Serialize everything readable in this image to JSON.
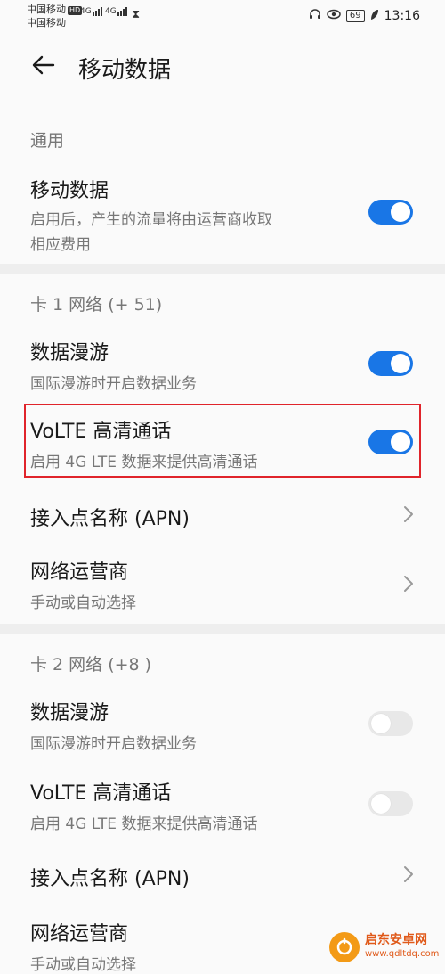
{
  "status_bar": {
    "carrier1": "中国移动",
    "carrier1_badge": "HD",
    "carrier2": "中国移动",
    "sig1_label": "4G",
    "sig2_label": "4G",
    "battery": "69",
    "time": "13:16",
    "icons": [
      "headset-icon",
      "eye-icon",
      "battery-icon",
      "leaf-icon",
      "hourglass-icon"
    ]
  },
  "app_bar": {
    "title": "移动数据"
  },
  "general": {
    "header": "通用",
    "mobile_data": {
      "title": "移动数据",
      "subtitle_line1": "启用后，产生的流量将由运营商收取",
      "subtitle_line2": "相应费用",
      "enabled": true
    }
  },
  "sim1": {
    "header": "卡 1 网络 (+                    51)",
    "roaming": {
      "title": "数据漫游",
      "subtitle": "国际漫游时开启数据业务",
      "enabled": true
    },
    "volte": {
      "title": "VoLTE 高清通话",
      "subtitle": "启用 4G LTE 数据来提供高清通话",
      "enabled": true
    },
    "apn": {
      "title": "接入点名称 (APN)"
    },
    "operator": {
      "title": "网络运营商",
      "subtitle": "手动或自动选择"
    }
  },
  "sim2": {
    "header": "卡 2 网络 (+8                    )",
    "roaming": {
      "title": "数据漫游",
      "subtitle": "国际漫游时开启数据业务",
      "enabled": false
    },
    "volte": {
      "title": "VoLTE 高清通话",
      "subtitle": "启用 4G LTE 数据来提供高清通话",
      "enabled": false
    },
    "apn": {
      "title": "接入点名称 (APN)"
    },
    "operator": {
      "title": "网络运营商",
      "subtitle": "手动或自动选择"
    }
  },
  "watermark": {
    "name": "启东安卓网",
    "url": "www.qdltdq.com"
  },
  "colors": {
    "accent": "#1976e6",
    "highlight": "#e0242b"
  }
}
